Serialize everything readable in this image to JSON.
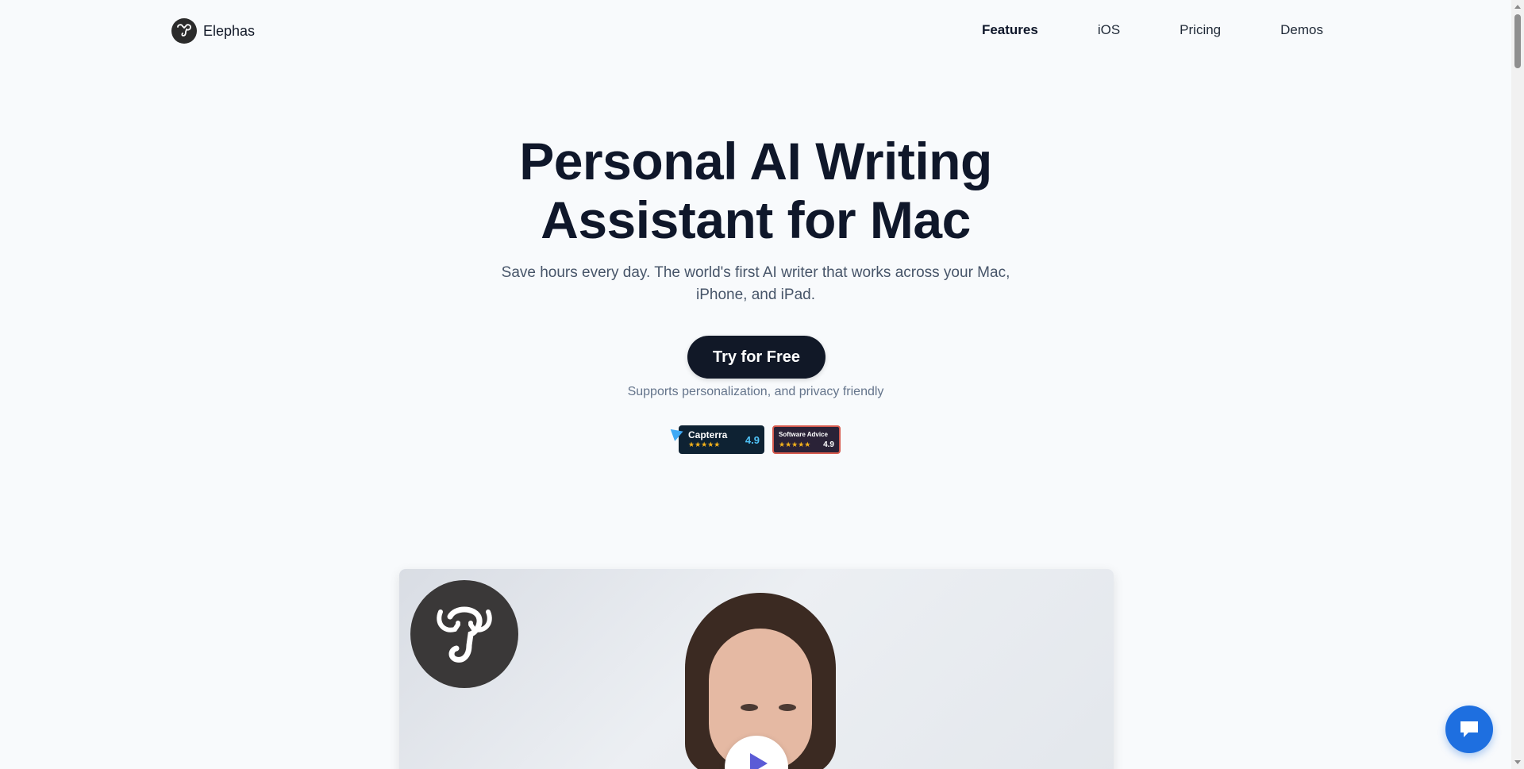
{
  "brand": {
    "name": "Elephas",
    "icon": "elephant-logo-icon"
  },
  "nav": {
    "items": [
      {
        "label": "Features",
        "active": true
      },
      {
        "label": "iOS",
        "active": false
      },
      {
        "label": "Pricing",
        "active": false
      },
      {
        "label": "Demos",
        "active": false
      }
    ]
  },
  "hero": {
    "title_line1": "Personal AI Writing",
    "title_line2": "Assistant for Mac",
    "subtitle_line1": "Save hours every day. The world's first AI writer that works across your Mac,",
    "subtitle_line2": "iPhone, and iPad.",
    "cta_label": "Try for Free",
    "cta_note": "Supports personalization, and privacy friendly"
  },
  "ratings": [
    {
      "source": "Capterra",
      "stars": "★★★★★",
      "score": "4.9"
    },
    {
      "source": "Software Advice",
      "stars": "★★★★★",
      "score": "4.9"
    }
  ],
  "video": {
    "logo_icon": "elephant-logo-icon",
    "play_icon": "play-icon"
  },
  "chat": {
    "icon": "chat-bubble-icon"
  },
  "colors": {
    "background": "#f8fafc",
    "text_primary": "#0f172a",
    "text_secondary": "#475569",
    "cta_bg": "#111827",
    "chat_bg": "#1e6fe0",
    "play_accent": "#5b5bd6"
  }
}
